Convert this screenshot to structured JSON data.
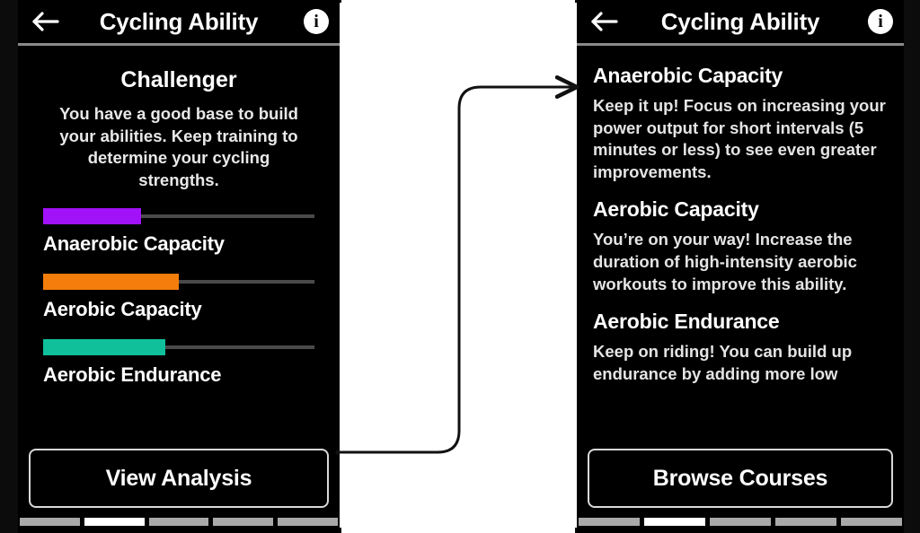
{
  "frame": {
    "background_color": "#0c0c0c",
    "canvas_color": "#ffffff"
  },
  "left_screen": {
    "header": {
      "title": "Cycling Ability",
      "back_icon": "arrow-left-icon",
      "info_icon": "info-circle-icon"
    },
    "level_title": "Challenger",
    "level_description": "You have a good base to build your abilities. Keep training to determine your cycling strengths.",
    "metrics": [
      {
        "label": "Anaerobic Capacity",
        "color": "#a112f8",
        "fill_percent": 36
      },
      {
        "label": "Aerobic Capacity",
        "color": "#f57d0b",
        "fill_percent": 50
      },
      {
        "label": "Aerobic Endurance",
        "color": "#10c09a",
        "fill_percent": 45
      }
    ],
    "cta_label": "View Analysis",
    "page_dots": {
      "count": 5,
      "active_index": 1
    }
  },
  "right_screen": {
    "header": {
      "title": "Cycling Ability",
      "back_icon": "arrow-left-icon",
      "info_icon": "info-circle-icon"
    },
    "sections": [
      {
        "heading": "Anaerobic Capacity",
        "body": "Keep it up! Focus on increasing your power output for short intervals (5 minutes or less) to see even greater improvements."
      },
      {
        "heading": "Aerobic Capacity",
        "body": "You’re on your way! Increase the duration of high-intensity aerobic workouts to improve this ability."
      },
      {
        "heading": "Aerobic Endurance",
        "body": "Keep on riding! You can build up endurance by adding more low"
      }
    ],
    "cta_label": "Browse Courses",
    "page_dots": {
      "count": 5,
      "active_index": 1
    }
  },
  "connector": {
    "name": "flow-arrow",
    "color": "#111111",
    "from": "view-analysis-button",
    "to": "right-screen-top"
  }
}
